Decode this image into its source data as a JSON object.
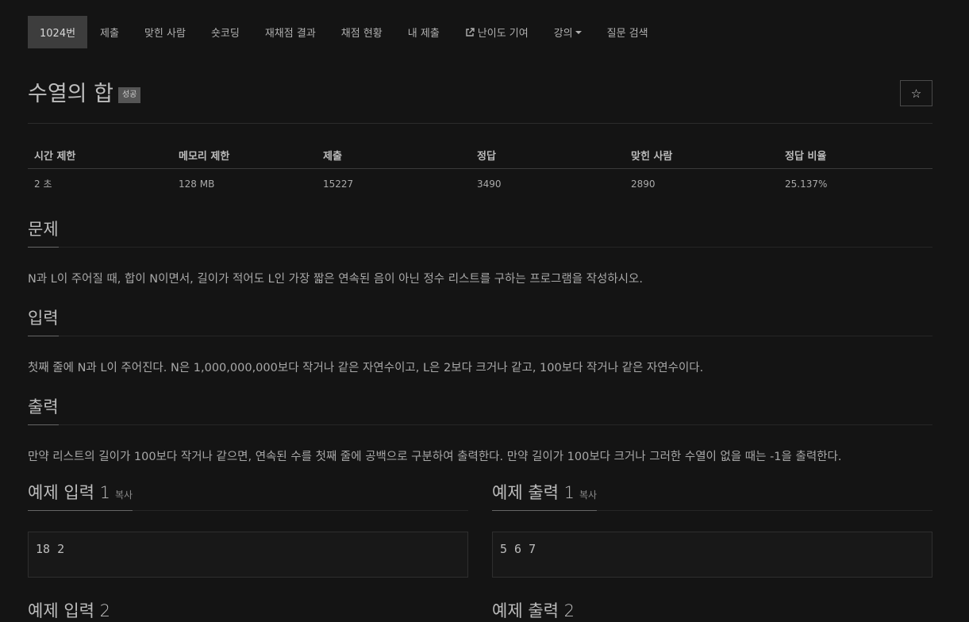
{
  "nav": {
    "items": [
      {
        "label": "1024번",
        "active": true
      },
      {
        "label": "제출"
      },
      {
        "label": "맞힌 사람"
      },
      {
        "label": "숏코딩"
      },
      {
        "label": "재채점 결과"
      },
      {
        "label": "채점 현황"
      },
      {
        "label": "내 제출"
      },
      {
        "label": "난이도 기여",
        "icon": "external-link-icon"
      },
      {
        "label": "강의",
        "icon": "caret-down-icon"
      },
      {
        "label": "질문 검색"
      }
    ]
  },
  "problem": {
    "title": "수열의 합",
    "badge": "성공",
    "star": "☆"
  },
  "info": {
    "headers": [
      "시간 제한",
      "메모리 제한",
      "제출",
      "정답",
      "맞힌 사람",
      "정답 비율"
    ],
    "values": [
      "2 초",
      "128 MB",
      "15227",
      "3490",
      "2890",
      "25.137%"
    ]
  },
  "sections": {
    "problem_title": "문제",
    "problem_text": "N과 L이 주어질 때, 합이 N이면서, 길이가 적어도 L인 가장 짧은 연속된 음이 아닌 정수 리스트를 구하는 프로그램을 작성하시오.",
    "input_title": "입력",
    "input_text": "첫째 줄에 N과 L이 주어진다. N은 1,000,000,000보다 작거나 같은 자연수이고, L은 2보다 크거나 같고, 100보다 작거나 같은 자연수이다.",
    "output_title": "출력",
    "output_text": "만약 리스트의 길이가 100보다 작거나 같으면, 연속된 수를 첫째 줄에 공백으로 구분하여 출력한다. 만약 길이가 100보다 크거나 그러한 수열이 없을 때는 -1을 출력한다."
  },
  "samples": {
    "input_title": "예제 입력 1",
    "output_title": "예제 출력 1",
    "copy_label": "복사",
    "input_value": "18 2",
    "output_value": "5 6 7",
    "next_input_title": "예제 입력 2",
    "next_output_title": "예제 출력 2"
  }
}
